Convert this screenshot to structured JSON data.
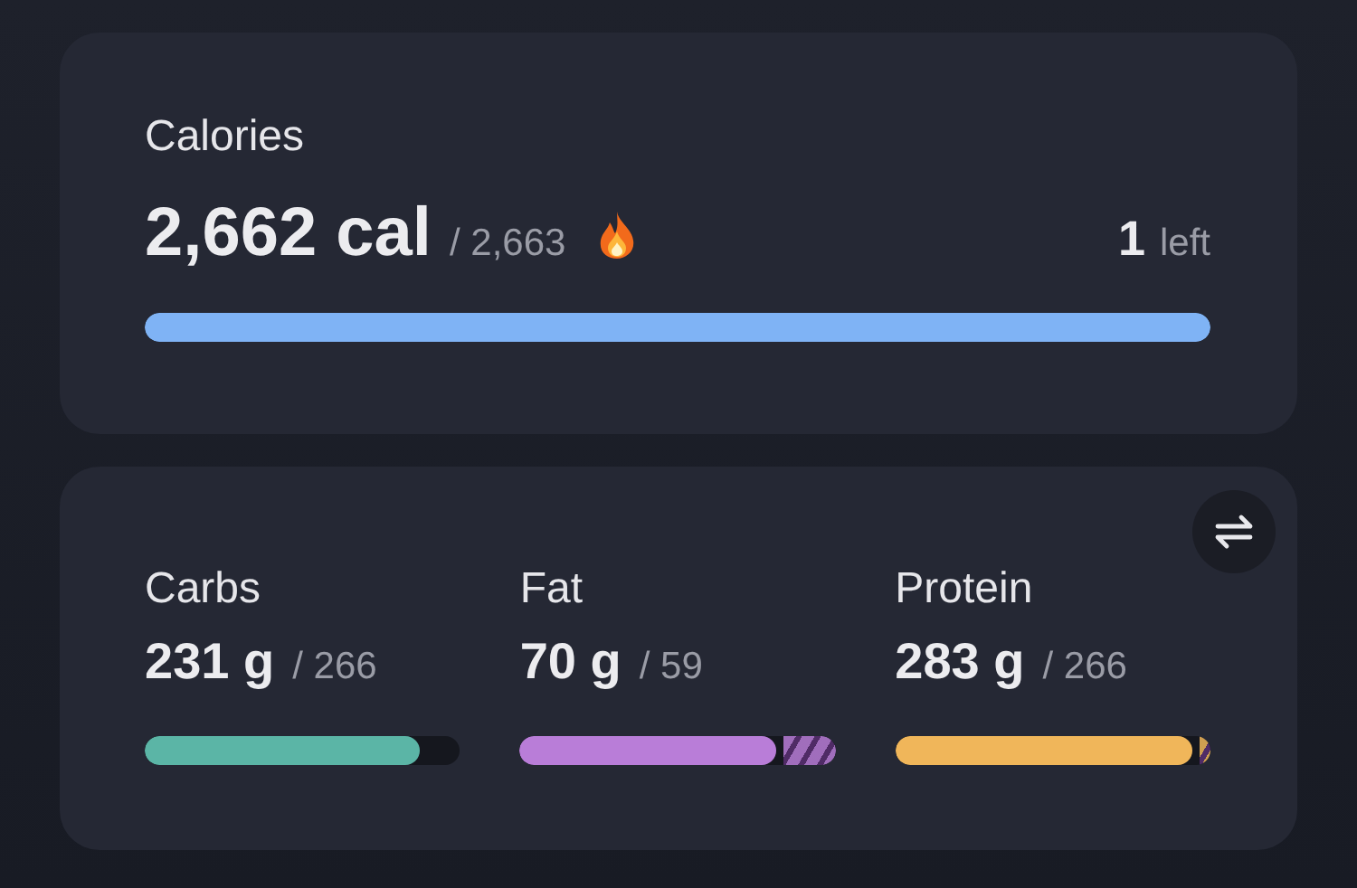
{
  "calories": {
    "title": "Calories",
    "value": "2,662 cal",
    "goal": "/ 2,663",
    "remaining": "1",
    "remaining_label": "left",
    "level": 1
  },
  "macros": [
    {
      "name": "Carbs",
      "value": "231 g",
      "goal": "/ 266",
      "kind": "under",
      "level": 0.87,
      "color": "#5bb5a6"
    },
    {
      "name": "Fat",
      "value": "70 g",
      "goal": "/ 59",
      "kind": "over",
      "level": 0.81,
      "color": "#b97dd8"
    },
    {
      "name": "Protein",
      "value": "283 g",
      "goal": "/ 266",
      "kind": "over",
      "level": 0.94,
      "color": "#f0b65a"
    }
  ]
}
